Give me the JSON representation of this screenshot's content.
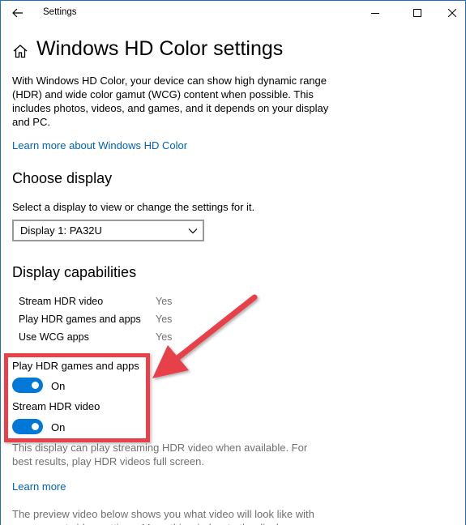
{
  "titlebar": {
    "title": "Settings",
    "icons": {
      "back": "back-arrow-icon",
      "minimize": "minimize-icon",
      "maximize": "maximize-icon",
      "close": "close-icon"
    }
  },
  "page": {
    "home_icon": "home-icon",
    "title": "Windows HD Color settings",
    "intro": "With Windows HD Color, your device can show high dynamic range (HDR) and wide color gamut (WCG) content when possible. This includes photos, videos, and games, and it depends on your display and PC.",
    "learn_more_hd": "Learn more about Windows HD Color"
  },
  "choose_display": {
    "heading": "Choose display",
    "label": "Select a display to view or change the settings for it.",
    "selected": "Display 1: PA32U"
  },
  "capabilities": {
    "heading": "Display capabilities",
    "rows": [
      {
        "name": "Stream HDR video",
        "value": "Yes"
      },
      {
        "name": "Play HDR games and apps",
        "value": "Yes"
      },
      {
        "name": "Use WCG apps",
        "value": "Yes"
      }
    ]
  },
  "toggles": [
    {
      "label": "Play HDR games and apps",
      "state": "On",
      "on": true
    },
    {
      "label": "Stream HDR video",
      "state": "On",
      "on": true
    }
  ],
  "notes": {
    "streaming": "This display can play streaming HDR video when available. For best results, play HDR videos full screen.",
    "learn_more": "Learn more",
    "preview": "The preview video below shows you what video will look like with your current video settings. Move this window to the display you want"
  },
  "colors": {
    "accent": "#0078d7",
    "link": "#0063b1",
    "annotation": "#e8414a"
  }
}
